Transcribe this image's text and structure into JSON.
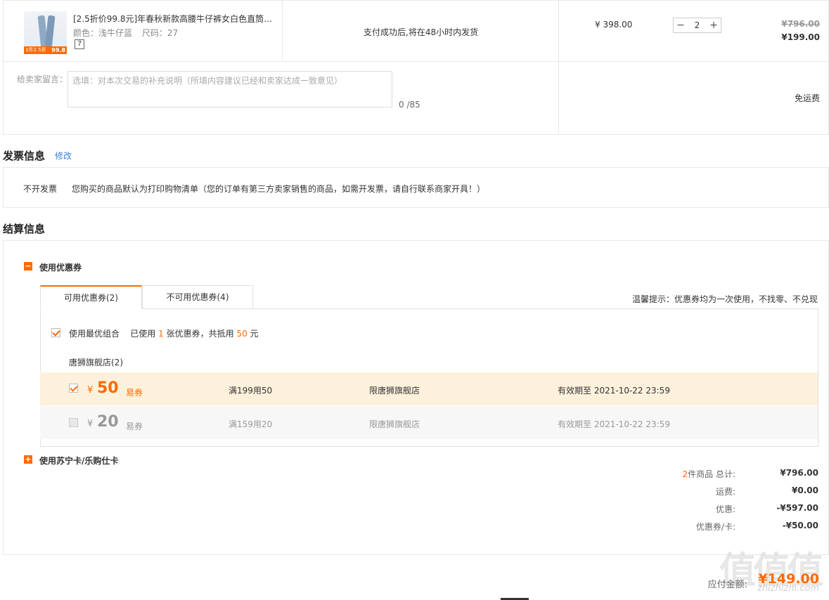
{
  "product": {
    "title": "[2.5折价99.8元]年春秋新款高腰牛仔裤女白色直筒…",
    "color_label": "颜色：浅牛仔蓝",
    "size_label": "尺码：27",
    "seven_day_badge": "7",
    "thumb_tag": "1件2.5折",
    "thumb_price": "99.8",
    "shipping_note": "支付成功后,将在48小时内发货",
    "unit_price": "¥ 398.00",
    "quantity": "2",
    "original_total": "¥796.00",
    "discounted_total": "¥199.00"
  },
  "message": {
    "label": "给卖家留言：",
    "placeholder": "选填：对本次交易的补充说明（所填内容建议已经和卖家达成一致意见）",
    "counter": "0 /85",
    "shipping_fee_text": "免运费"
  },
  "invoice": {
    "title": "发票信息",
    "edit_link": "修改",
    "type": "不开发票",
    "description": "您购买的商品默认为打印购物清单（您的订单有第三方卖家销售的商品，如需开发票，请自行联系商家开具！）"
  },
  "settlement": {
    "title": "结算信息",
    "coupon_section": {
      "toggle": "−",
      "label": "使用优惠券",
      "tabs": [
        {
          "label": "可用优惠券(2)"
        },
        {
          "label": "不可用优惠券(4)"
        }
      ],
      "hint": "温馨提示：优惠券均为一次使用，不找零、不兑现",
      "combo_label": "使用最优组合",
      "combo_used_pre": "已使用",
      "combo_used_count": "1",
      "combo_used_mid": "张优惠券，共抵用",
      "combo_used_amount": "50",
      "combo_used_unit": "元",
      "store_name": "唐狮旗舰店(2)",
      "coupons": [
        {
          "currency": "¥",
          "amount": "50",
          "type": "易券",
          "condition": "满199用50",
          "scope": "限唐狮旗舰店",
          "expiry": "有效期至 2021-10-22 23:59"
        },
        {
          "currency": "¥",
          "amount": "20",
          "type": "易券",
          "condition": "满159用20",
          "scope": "限唐狮旗舰店",
          "expiry": "有效期至 2021-10-22 23:59"
        }
      ]
    },
    "card_section": {
      "toggle": "+",
      "label": "使用苏宁卡/乐购仕卡"
    },
    "summary": {
      "items_count": "2",
      "items_label": "件商品 总计:",
      "items_total": "¥796.00",
      "shipping_label": "运费:",
      "shipping_value": "¥0.00",
      "discount_label": "优惠:",
      "discount_value": "-¥597.00",
      "coupon_label": "优惠券/卡:",
      "coupon_value": "-¥50.00"
    },
    "payable_label": "应付金额:",
    "payable_value": "¥149.00"
  },
  "watermark": {
    "text": "值值值",
    "sub": "zhizhizhi.com"
  },
  "colors": {
    "accent": "#ff6a00",
    "coupon_selected_bg": "#fdf1dc",
    "coupon_unselected_bg": "#f7f7f7"
  }
}
